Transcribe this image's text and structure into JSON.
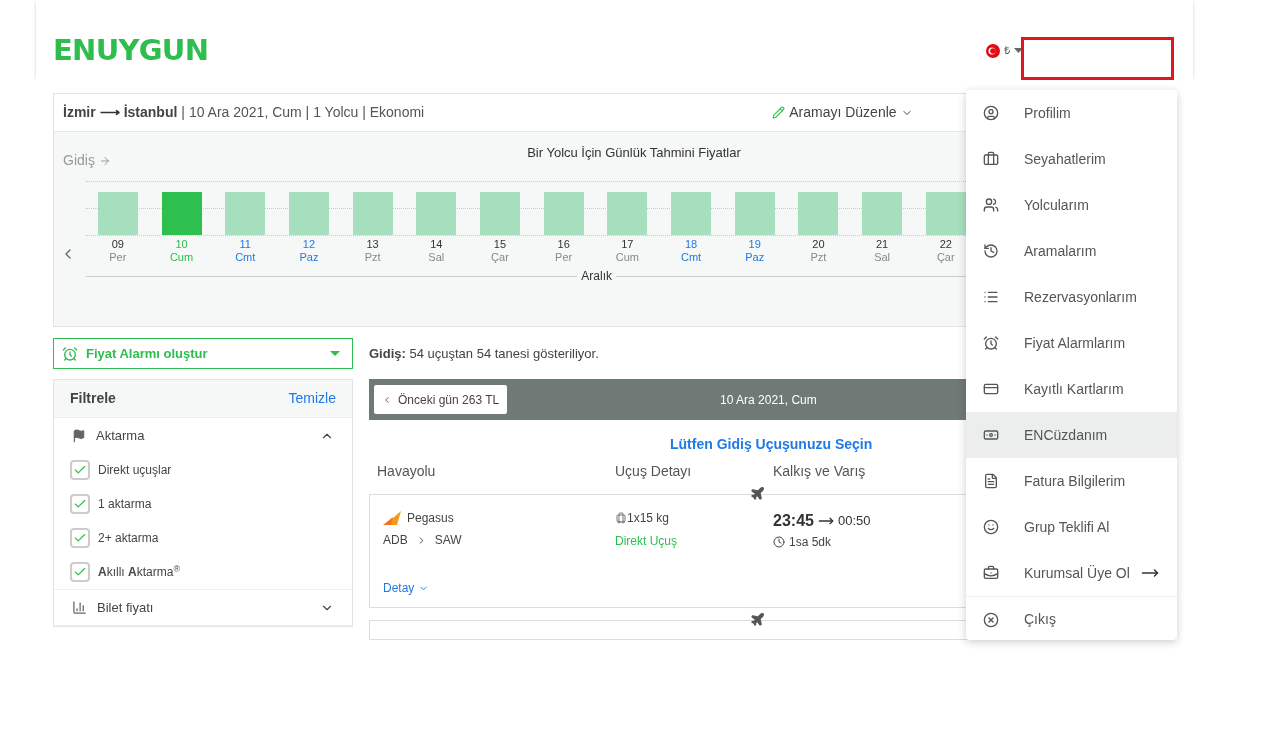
{
  "header": {
    "logo": "ENUYGUN",
    "currency": "₺"
  },
  "search": {
    "route_from": "İzmir",
    "route_to": "İstanbul",
    "route_arrow": "⟶",
    "details": "| 10 Ara 2021, Cum | 1 Yolcu | Ekonomi",
    "edit": "Aramayı Düzenle"
  },
  "calendar": {
    "direction": "Gidiş",
    "title": "Bir Yolcu İçin Günlük Tahmini Fiyatlar",
    "month": "Aralık",
    "days": [
      {
        "day": "09",
        "weekday": "Per",
        "selected": false,
        "weekend": false
      },
      {
        "day": "10",
        "weekday": "Cum",
        "selected": true,
        "weekend": false
      },
      {
        "day": "11",
        "weekday": "Cmt",
        "selected": false,
        "weekend": true
      },
      {
        "day": "12",
        "weekday": "Paz",
        "selected": false,
        "weekend": true
      },
      {
        "day": "13",
        "weekday": "Pzt",
        "selected": false,
        "weekend": false
      },
      {
        "day": "14",
        "weekday": "Sal",
        "selected": false,
        "weekend": false
      },
      {
        "day": "15",
        "weekday": "Çar",
        "selected": false,
        "weekend": false
      },
      {
        "day": "16",
        "weekday": "Per",
        "selected": false,
        "weekend": false
      },
      {
        "day": "17",
        "weekday": "Cum",
        "selected": false,
        "weekend": false
      },
      {
        "day": "18",
        "weekday": "Cmt",
        "selected": false,
        "weekend": true
      },
      {
        "day": "19",
        "weekday": "Paz",
        "selected": false,
        "weekend": true
      },
      {
        "day": "20",
        "weekday": "Pzt",
        "selected": false,
        "weekend": false
      },
      {
        "day": "21",
        "weekday": "Sal",
        "selected": false,
        "weekend": false
      },
      {
        "day": "22",
        "weekday": "Çar",
        "selected": false,
        "weekend": false
      }
    ]
  },
  "price_alarm": "Fiyat Alarmı oluştur",
  "filters": {
    "title": "Filtrele",
    "clear": "Temizle",
    "sections": [
      {
        "title": "Aktarma",
        "expanded": true,
        "options": [
          {
            "label": "Direkt uçuşlar",
            "checked": true
          },
          {
            "label": "1 aktarma",
            "checked": true
          },
          {
            "label": "2+ aktarma",
            "checked": true
          },
          {
            "label": "**A**kıllı **A**ktarma$^{®}$",
            "checked": true
          }
        ]
      },
      {
        "title": "Bilet fiyatı",
        "expanded": false
      }
    ]
  },
  "results": {
    "summary_label": "Gidiş:",
    "summary": "54 uçuştan 54 tanesi gösteriliyor.",
    "prev_day": "Önceki gün 263 TL",
    "date": "10 Ara 2021, Cum",
    "prompt": "Lütfen Gidiş Uçuşunuzu Seçin",
    "columns": [
      "Havayolu",
      "Uçuş Detayı",
      "Kalkış ve Varış"
    ],
    "flights": [
      {
        "airline": "Pegasus",
        "from": "ADB",
        "to": "SAW",
        "baggage": "1x15 kg",
        "type": "Direkt Uçuş",
        "departure": "23:45",
        "arrival": "00:50",
        "duration": "1sa 5dk",
        "detail": "Detay"
      }
    ]
  },
  "user_menu": [
    {
      "label": "Profilim",
      "selected": false
    },
    {
      "label": "Seyahatlerim",
      "selected": false
    },
    {
      "label": "Yolcularım",
      "selected": false
    },
    {
      "label": "Aramalarım",
      "selected": false
    },
    {
      "label": "Rezervasyonlarım",
      "selected": false
    },
    {
      "label": "Fiyat Alarmlarım",
      "selected": false
    },
    {
      "label": "Kayıtlı Kartlarım",
      "selected": false
    },
    {
      "label": "ENCüzdanım",
      "selected": true
    },
    {
      "label": "Fatura Bilgilerim",
      "selected": false
    },
    {
      "label": "Grup Teklifi Al",
      "selected": false
    },
    {
      "label": "Kurumsal Üye Ol",
      "selected": false
    },
    {
      "label": "Çıkış",
      "selected": false
    }
  ]
}
